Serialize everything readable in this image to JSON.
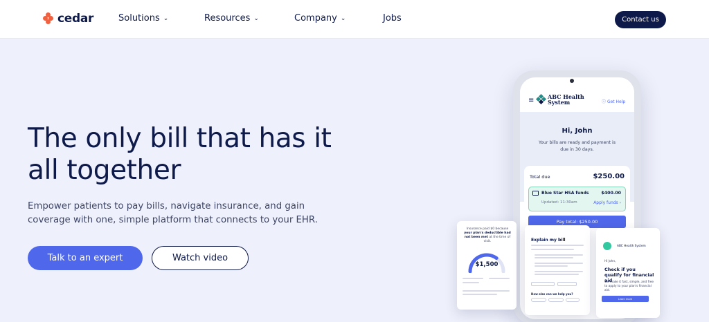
{
  "nav": {
    "logo_text": "cedar",
    "items": [
      {
        "label": "Solutions",
        "has_dropdown": true
      },
      {
        "label": "Resources",
        "has_dropdown": true
      },
      {
        "label": "Company",
        "has_dropdown": true
      },
      {
        "label": "Jobs",
        "has_dropdown": false
      }
    ],
    "contact_label": "Contact us"
  },
  "hero": {
    "headline": "The only bill that has it all together",
    "subtext": "Empower patients to pay bills, navigate insurance, and gain coverage with one, simple platform that connects to your EHR.",
    "primary_cta": "Talk to an expert",
    "secondary_cta": "Watch video"
  },
  "phone": {
    "org_name": "ABC Health System",
    "help_label": "Get Help",
    "greeting": "Hi, John",
    "greeting_sub": "Your bills are ready and payment is due in 30 days.",
    "total_label": "Total due",
    "total_value": "$250.00",
    "hsa_name": "Blue Star HSA funds",
    "hsa_amount": "$400.00",
    "hsa_updated": "Updated: 11:30am",
    "hsa_apply": "Apply funds ›",
    "pay_label": "Pay total: $250.00"
  },
  "cards": {
    "insurance_text_1": "Insurance paid $0 because",
    "insurance_text_2": "your plan's deductible had not been met",
    "insurance_text_3": "at the time of visit.",
    "deductible_amount": "$1,500",
    "deductible_progress_pct": 70,
    "explain_title": "Explain my bill",
    "explain_ask": "How else can we help you?",
    "aid_org": "ABC Health System",
    "aid_greeting": "Hi John,",
    "aid_title": "Check if you qualify for financial aid",
    "aid_body": "We make it fast, simple, and free to apply to your plan's financial aid.",
    "aid_button": "Learn more"
  },
  "colors": {
    "navy": "#0e1a4a",
    "accent": "#4f67ea",
    "brand_orange": "#f2613f",
    "hero_bg": "#eef0fb"
  }
}
